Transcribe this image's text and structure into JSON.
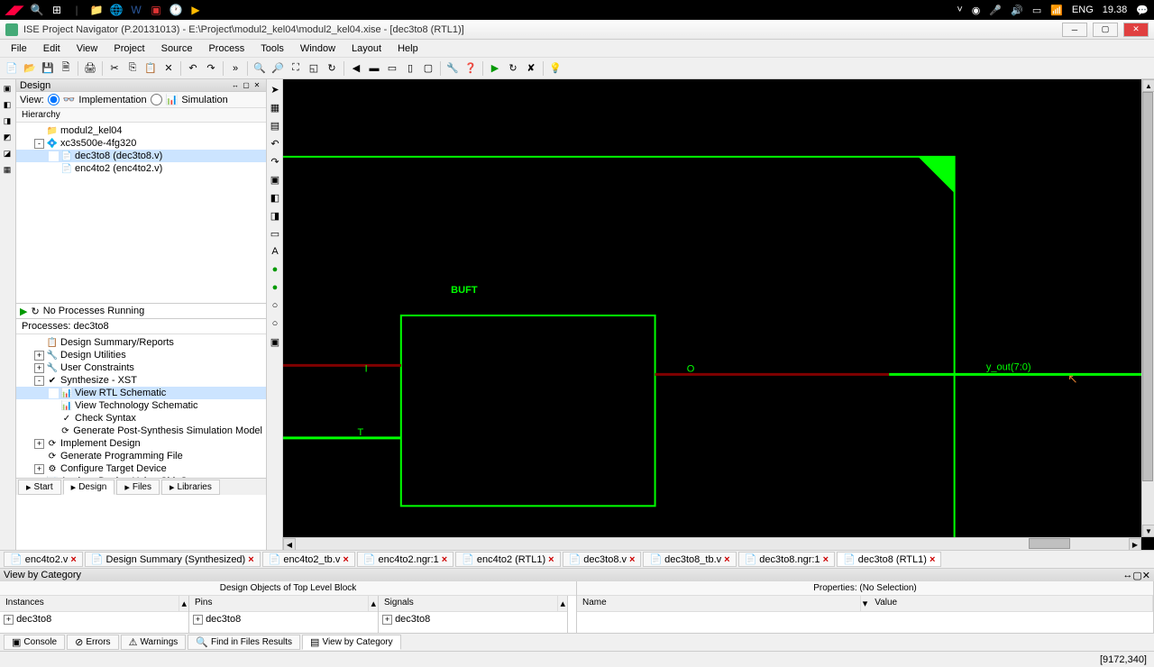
{
  "taskbar": {
    "right": {
      "lang": "ENG",
      "time": "19.38"
    }
  },
  "titlebar": {
    "text": "ISE Project Navigator (P.20131013) - E:\\Project\\modul2_kel04\\modul2_kel04.xise - [dec3to8 (RTL1)]"
  },
  "menu": [
    "File",
    "Edit",
    "View",
    "Project",
    "Source",
    "Process",
    "Tools",
    "Window",
    "Layout",
    "Help"
  ],
  "design_panel": {
    "title": "Design",
    "view_label": "View:",
    "impl": "Implementation",
    "sim": "Simulation",
    "hierarchy": "Hierarchy",
    "tree": [
      {
        "indent": 0,
        "exp": "",
        "icn": "📁",
        "label": "modul2_kel04"
      },
      {
        "indent": 0,
        "exp": "-",
        "icn": "💠",
        "label": "xc3s500e-4fg320"
      },
      {
        "indent": 1,
        "exp": "",
        "icn": "📄",
        "label": "dec3to8 (dec3to8.v)",
        "selected": true
      },
      {
        "indent": 1,
        "exp": "",
        "icn": "📄",
        "label": "enc4to2 (enc4to2.v)"
      }
    ],
    "no_proc": "No Processes Running",
    "proc_label": "Processes: dec3to8",
    "processes": [
      {
        "indent": 0,
        "exp": "",
        "icn": "📋",
        "label": "Design Summary/Reports"
      },
      {
        "indent": 0,
        "exp": "+",
        "icn": "🔧",
        "label": "Design Utilities"
      },
      {
        "indent": 0,
        "exp": "+",
        "icn": "🔧",
        "label": "User Constraints"
      },
      {
        "indent": 0,
        "exp": "-",
        "icn": "✔",
        "label": "Synthesize - XST"
      },
      {
        "indent": 1,
        "exp": "",
        "icn": "📊",
        "label": "View RTL Schematic",
        "selected": true
      },
      {
        "indent": 1,
        "exp": "",
        "icn": "📊",
        "label": "View Technology Schematic"
      },
      {
        "indent": 1,
        "exp": "",
        "icn": "✓",
        "label": "Check Syntax"
      },
      {
        "indent": 1,
        "exp": "",
        "icn": "⟳",
        "label": "Generate Post-Synthesis Simulation Model"
      },
      {
        "indent": 0,
        "exp": "+",
        "icn": "⟳",
        "label": "Implement Design"
      },
      {
        "indent": 0,
        "exp": "",
        "icn": "⟳",
        "label": "Generate Programming File"
      },
      {
        "indent": 0,
        "exp": "+",
        "icn": "⚙",
        "label": "Configure Target Device"
      },
      {
        "indent": 0,
        "exp": "",
        "icn": "📊",
        "label": "Analyze Design Using ChipScope"
      }
    ],
    "tabs": [
      "Start",
      "Design",
      "Files",
      "Libraries"
    ]
  },
  "schematic": {
    "block_label": "BUFT",
    "port_i": "I",
    "port_t": "T",
    "port_o": "O",
    "net_out": "y_out(7:0)"
  },
  "doc_tabs": [
    {
      "label": "enc4to2.v"
    },
    {
      "label": "Design Summary (Synthesized)"
    },
    {
      "label": "enc4to2_tb.v"
    },
    {
      "label": "enc4to2.ngr:1"
    },
    {
      "label": "enc4to2 (RTL1)"
    },
    {
      "label": "dec3to8.v"
    },
    {
      "label": "dec3to8_tb.v"
    },
    {
      "label": "dec3to8.ngr:1"
    },
    {
      "label": "dec3to8 (RTL1)",
      "active": true
    }
  ],
  "lower": {
    "header": "View by Category",
    "objects_title": "Design Objects of Top Level Block",
    "props_title": "Properties: (No Selection)",
    "instances": "Instances",
    "pins": "Pins",
    "signals": "Signals",
    "name": "Name",
    "value": "Value",
    "item": "dec3to8",
    "tabs": [
      "Console",
      "Errors",
      "Warnings",
      "Find in Files Results",
      "View by Category"
    ]
  },
  "status": "[9172,340]"
}
